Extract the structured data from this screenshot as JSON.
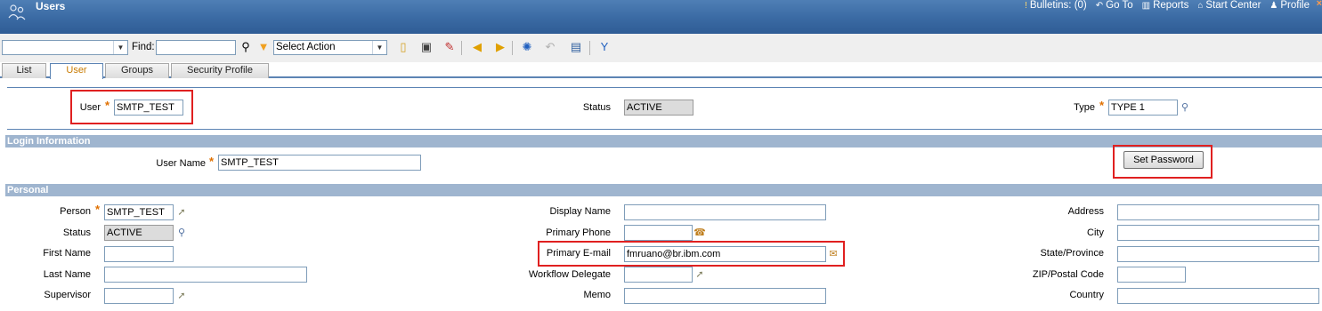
{
  "app": {
    "title": "Users"
  },
  "topnav": {
    "bulletins": "Bulletins: (0)",
    "goto": "Go To",
    "reports": "Reports",
    "start_center": "Start Center",
    "profile": "Profile"
  },
  "toolbar": {
    "find_label": "Find:",
    "find_value": "",
    "query_value": "",
    "action_select": "Select Action"
  },
  "tabs": [
    "List",
    "User",
    "Groups",
    "Security Profile"
  ],
  "user_header": {
    "user_label": "User",
    "user_value": "SMTP_TEST",
    "status_label": "Status",
    "status_value": "ACTIVE",
    "type_label": "Type",
    "type_value": "TYPE 1"
  },
  "login": {
    "section_title": "Login Information",
    "username_label": "User Name",
    "username_value": "SMTP_TEST",
    "set_password": "Set Password"
  },
  "personal": {
    "section_title": "Personal",
    "person_label": "Person",
    "person_value": "SMTP_TEST",
    "status_label": "Status",
    "status_value": "ACTIVE",
    "firstname_label": "First Name",
    "firstname_value": "",
    "lastname_label": "Last Name",
    "lastname_value": "",
    "supervisor_label": "Supervisor",
    "supervisor_value": "",
    "displayname_label": "Display Name",
    "displayname_value": "",
    "phone_label": "Primary Phone",
    "phone_value": "",
    "email_label": "Primary E-mail",
    "email_value": "fmruano@br.ibm.com",
    "delegate_label": "Workflow Delegate",
    "delegate_value": "",
    "memo_label": "Memo",
    "memo_value": "",
    "address_label": "Address",
    "address_value": "",
    "city_label": "City",
    "city_value": "",
    "state_label": "State/Province",
    "state_value": "",
    "zip_label": "ZIP/Postal Code",
    "zip_value": "",
    "country_label": "Country",
    "country_value": ""
  }
}
